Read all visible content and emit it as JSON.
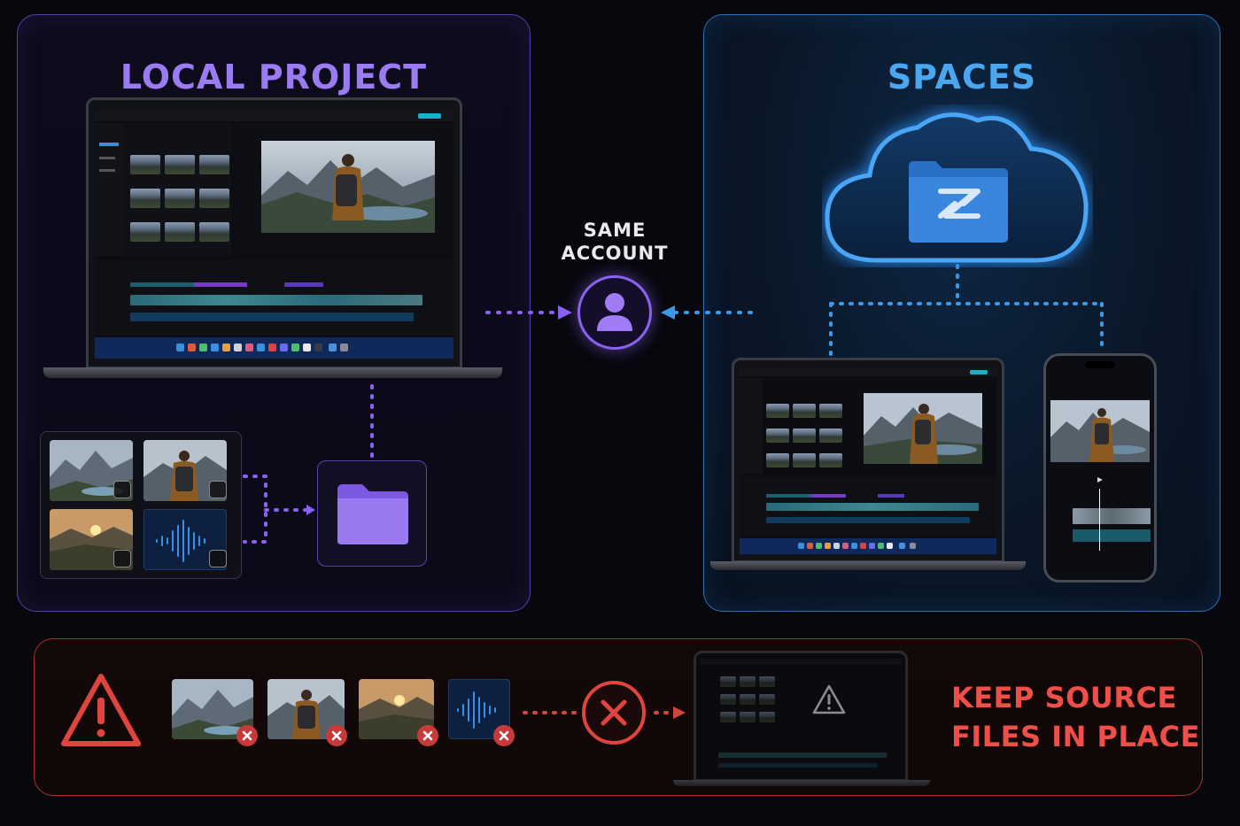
{
  "local_panel": {
    "title": "LOCAL PROJECT"
  },
  "spaces_panel": {
    "title": "SPACES"
  },
  "account": {
    "line1": "SAME",
    "line2": "ACCOUNT"
  },
  "warning_panel": {
    "line1": "KEEP SOURCE",
    "line2": "FILES IN PLACE"
  },
  "icons": {
    "account": "user-icon",
    "cloud": "cloud-icon",
    "warning": "warning-triangle-icon",
    "blocked": "x-circle-icon",
    "folder": "folder-icon",
    "audio": "audio-waveform-icon"
  },
  "colors": {
    "local_accent": "#9b7bf2",
    "spaces_accent": "#4aa6ee",
    "warning_accent": "#ee4f48"
  }
}
